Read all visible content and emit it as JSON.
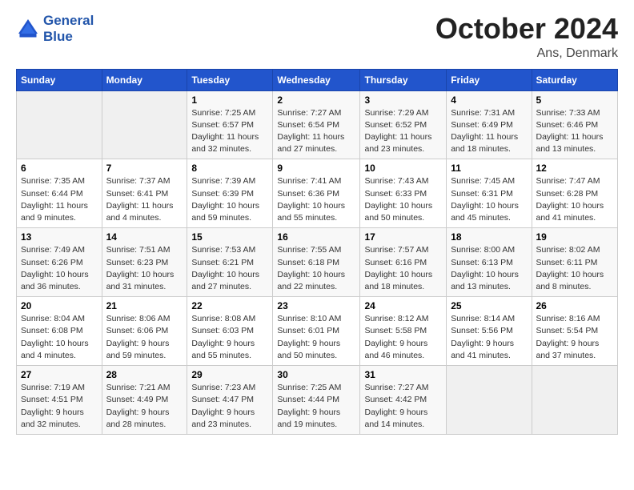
{
  "header": {
    "logo_line1": "General",
    "logo_line2": "Blue",
    "month": "October 2024",
    "location": "Ans, Denmark"
  },
  "weekdays": [
    "Sunday",
    "Monday",
    "Tuesday",
    "Wednesday",
    "Thursday",
    "Friday",
    "Saturday"
  ],
  "weeks": [
    [
      {
        "day": "",
        "sunrise": "",
        "sunset": "",
        "daylight": ""
      },
      {
        "day": "",
        "sunrise": "",
        "sunset": "",
        "daylight": ""
      },
      {
        "day": "1",
        "sunrise": "Sunrise: 7:25 AM",
        "sunset": "Sunset: 6:57 PM",
        "daylight": "Daylight: 11 hours and 32 minutes."
      },
      {
        "day": "2",
        "sunrise": "Sunrise: 7:27 AM",
        "sunset": "Sunset: 6:54 PM",
        "daylight": "Daylight: 11 hours and 27 minutes."
      },
      {
        "day": "3",
        "sunrise": "Sunrise: 7:29 AM",
        "sunset": "Sunset: 6:52 PM",
        "daylight": "Daylight: 11 hours and 23 minutes."
      },
      {
        "day": "4",
        "sunrise": "Sunrise: 7:31 AM",
        "sunset": "Sunset: 6:49 PM",
        "daylight": "Daylight: 11 hours and 18 minutes."
      },
      {
        "day": "5",
        "sunrise": "Sunrise: 7:33 AM",
        "sunset": "Sunset: 6:46 PM",
        "daylight": "Daylight: 11 hours and 13 minutes."
      }
    ],
    [
      {
        "day": "6",
        "sunrise": "Sunrise: 7:35 AM",
        "sunset": "Sunset: 6:44 PM",
        "daylight": "Daylight: 11 hours and 9 minutes."
      },
      {
        "day": "7",
        "sunrise": "Sunrise: 7:37 AM",
        "sunset": "Sunset: 6:41 PM",
        "daylight": "Daylight: 11 hours and 4 minutes."
      },
      {
        "day": "8",
        "sunrise": "Sunrise: 7:39 AM",
        "sunset": "Sunset: 6:39 PM",
        "daylight": "Daylight: 10 hours and 59 minutes."
      },
      {
        "day": "9",
        "sunrise": "Sunrise: 7:41 AM",
        "sunset": "Sunset: 6:36 PM",
        "daylight": "Daylight: 10 hours and 55 minutes."
      },
      {
        "day": "10",
        "sunrise": "Sunrise: 7:43 AM",
        "sunset": "Sunset: 6:33 PM",
        "daylight": "Daylight: 10 hours and 50 minutes."
      },
      {
        "day": "11",
        "sunrise": "Sunrise: 7:45 AM",
        "sunset": "Sunset: 6:31 PM",
        "daylight": "Daylight: 10 hours and 45 minutes."
      },
      {
        "day": "12",
        "sunrise": "Sunrise: 7:47 AM",
        "sunset": "Sunset: 6:28 PM",
        "daylight": "Daylight: 10 hours and 41 minutes."
      }
    ],
    [
      {
        "day": "13",
        "sunrise": "Sunrise: 7:49 AM",
        "sunset": "Sunset: 6:26 PM",
        "daylight": "Daylight: 10 hours and 36 minutes."
      },
      {
        "day": "14",
        "sunrise": "Sunrise: 7:51 AM",
        "sunset": "Sunset: 6:23 PM",
        "daylight": "Daylight: 10 hours and 31 minutes."
      },
      {
        "day": "15",
        "sunrise": "Sunrise: 7:53 AM",
        "sunset": "Sunset: 6:21 PM",
        "daylight": "Daylight: 10 hours and 27 minutes."
      },
      {
        "day": "16",
        "sunrise": "Sunrise: 7:55 AM",
        "sunset": "Sunset: 6:18 PM",
        "daylight": "Daylight: 10 hours and 22 minutes."
      },
      {
        "day": "17",
        "sunrise": "Sunrise: 7:57 AM",
        "sunset": "Sunset: 6:16 PM",
        "daylight": "Daylight: 10 hours and 18 minutes."
      },
      {
        "day": "18",
        "sunrise": "Sunrise: 8:00 AM",
        "sunset": "Sunset: 6:13 PM",
        "daylight": "Daylight: 10 hours and 13 minutes."
      },
      {
        "day": "19",
        "sunrise": "Sunrise: 8:02 AM",
        "sunset": "Sunset: 6:11 PM",
        "daylight": "Daylight: 10 hours and 8 minutes."
      }
    ],
    [
      {
        "day": "20",
        "sunrise": "Sunrise: 8:04 AM",
        "sunset": "Sunset: 6:08 PM",
        "daylight": "Daylight: 10 hours and 4 minutes."
      },
      {
        "day": "21",
        "sunrise": "Sunrise: 8:06 AM",
        "sunset": "Sunset: 6:06 PM",
        "daylight": "Daylight: 9 hours and 59 minutes."
      },
      {
        "day": "22",
        "sunrise": "Sunrise: 8:08 AM",
        "sunset": "Sunset: 6:03 PM",
        "daylight": "Daylight: 9 hours and 55 minutes."
      },
      {
        "day": "23",
        "sunrise": "Sunrise: 8:10 AM",
        "sunset": "Sunset: 6:01 PM",
        "daylight": "Daylight: 9 hours and 50 minutes."
      },
      {
        "day": "24",
        "sunrise": "Sunrise: 8:12 AM",
        "sunset": "Sunset: 5:58 PM",
        "daylight": "Daylight: 9 hours and 46 minutes."
      },
      {
        "day": "25",
        "sunrise": "Sunrise: 8:14 AM",
        "sunset": "Sunset: 5:56 PM",
        "daylight": "Daylight: 9 hours and 41 minutes."
      },
      {
        "day": "26",
        "sunrise": "Sunrise: 8:16 AM",
        "sunset": "Sunset: 5:54 PM",
        "daylight": "Daylight: 9 hours and 37 minutes."
      }
    ],
    [
      {
        "day": "27",
        "sunrise": "Sunrise: 7:19 AM",
        "sunset": "Sunset: 4:51 PM",
        "daylight": "Daylight: 9 hours and 32 minutes."
      },
      {
        "day": "28",
        "sunrise": "Sunrise: 7:21 AM",
        "sunset": "Sunset: 4:49 PM",
        "daylight": "Daylight: 9 hours and 28 minutes."
      },
      {
        "day": "29",
        "sunrise": "Sunrise: 7:23 AM",
        "sunset": "Sunset: 4:47 PM",
        "daylight": "Daylight: 9 hours and 23 minutes."
      },
      {
        "day": "30",
        "sunrise": "Sunrise: 7:25 AM",
        "sunset": "Sunset: 4:44 PM",
        "daylight": "Daylight: 9 hours and 19 minutes."
      },
      {
        "day": "31",
        "sunrise": "Sunrise: 7:27 AM",
        "sunset": "Sunset: 4:42 PM",
        "daylight": "Daylight: 9 hours and 14 minutes."
      },
      {
        "day": "",
        "sunrise": "",
        "sunset": "",
        "daylight": ""
      },
      {
        "day": "",
        "sunrise": "",
        "sunset": "",
        "daylight": ""
      }
    ]
  ]
}
